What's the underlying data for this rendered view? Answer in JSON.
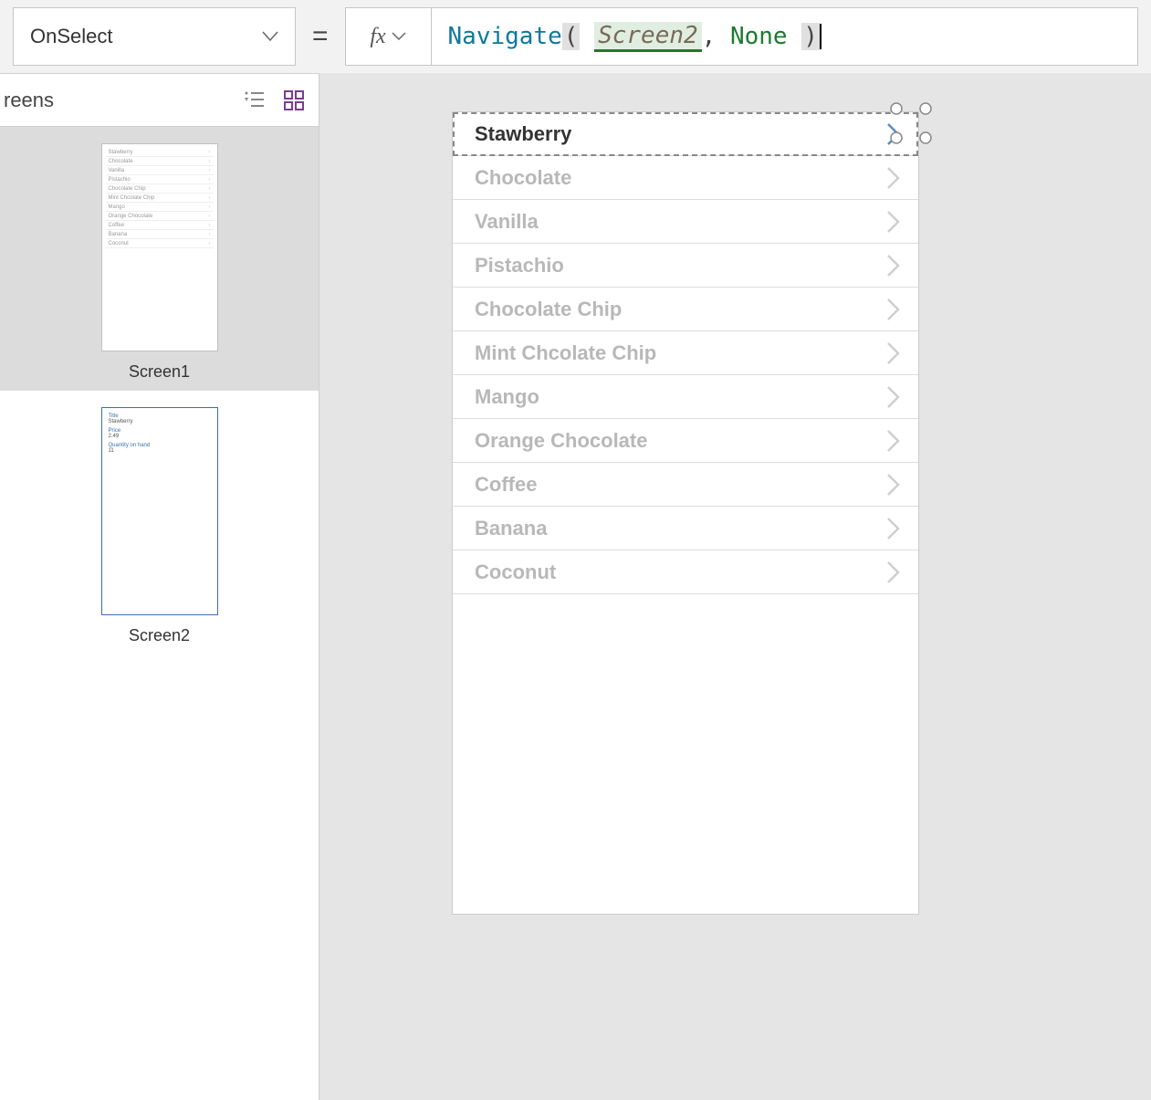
{
  "formula": {
    "property": "OnSelect",
    "func": "Navigate",
    "arg1": "Screen2",
    "arg_none": "None"
  },
  "panel": {
    "title": "reens"
  },
  "thumbs": {
    "screen1": {
      "label": "Screen1"
    },
    "screen2": {
      "label": "Screen2",
      "title_lbl": "Title",
      "title_val": "Stawberry",
      "price_lbl": "Price",
      "price_val": "2.49",
      "qty_lbl": "Quantity on hand",
      "qty_val": "11"
    }
  },
  "gallery": {
    "items": [
      "Stawberry",
      "Chocolate",
      "Vanilla",
      "Pistachio",
      "Chocolate Chip",
      "Mint Chcolate Chip",
      "Mango",
      "Orange Chocolate",
      "Coffee",
      "Banana",
      "Coconut"
    ]
  },
  "thumb_list": [
    "Stawberry",
    "Chocolate",
    "Vanilla",
    "Pistachio",
    "Chocolate Chip",
    "Mint Chcolate Chip",
    "Mango",
    "Orange Chocolate",
    "Coffee",
    "Banana",
    "Coconut"
  ]
}
